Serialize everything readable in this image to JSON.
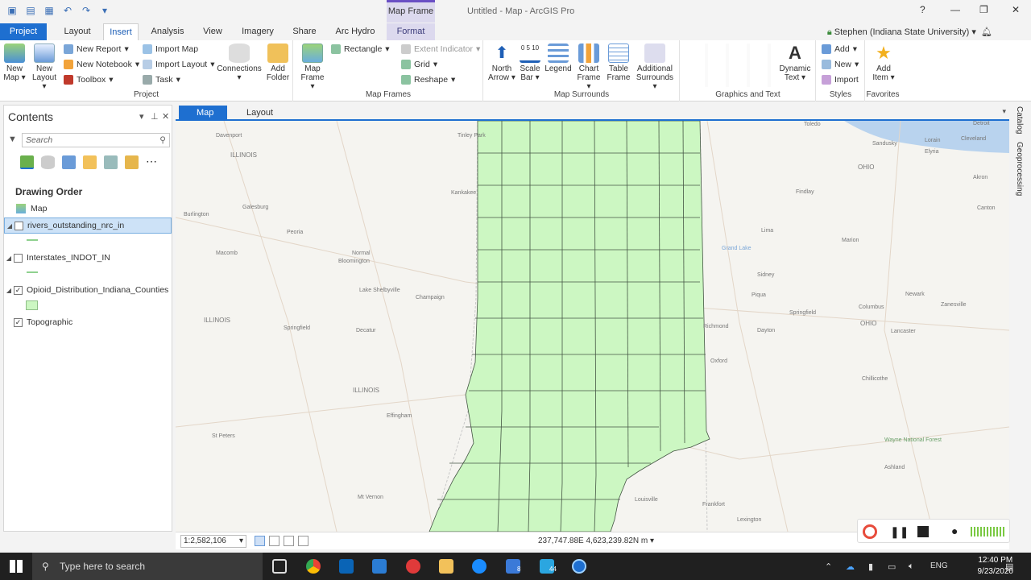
{
  "window": {
    "title": "Untitled - Map - ArcGIS Pro",
    "context_tab_header": "Map Frame"
  },
  "ribbon_tabs": [
    "Project",
    "Layout",
    "Insert",
    "Analysis",
    "View",
    "Imagery",
    "Share",
    "Arc Hydro",
    "Format"
  ],
  "user": "Stephen (Indiana State University)",
  "ribbon": {
    "project": {
      "label": "Project",
      "new_map": "New Map",
      "new_layout": "New Layout",
      "new_report": "New Report",
      "new_notebook": "New Notebook",
      "toolbox": "Toolbox",
      "import_map": "Import Map",
      "import_layout": "Import Layout",
      "task": "Task",
      "connections": "Connections",
      "add_folder": "Add Folder"
    },
    "map_frames": {
      "label": "Map Frames",
      "map_frame": "Map Frame",
      "rectangle": "Rectangle",
      "extent_indicator": "Extent Indicator",
      "grid": "Grid",
      "reshape": "Reshape"
    },
    "map_surrounds": {
      "label": "Map Surrounds",
      "north_arrow": "North Arrow",
      "scale_bar": "Scale Bar",
      "legend": "Legend",
      "chart_frame": "Chart Frame",
      "table_frame": "Table Frame",
      "additional_surrounds": "Additional Surrounds",
      "scale_icon_text": "0 5 10"
    },
    "graphics_text": {
      "label": "Graphics and Text",
      "dynamic_text": "Dynamic Text"
    },
    "styles": {
      "label": "Styles",
      "add": "Add",
      "new": "New",
      "import": "Import"
    },
    "favorites": {
      "label": "Favorites",
      "add_item": "Add Item"
    }
  },
  "contents": {
    "title": "Contents",
    "search_placeholder": "Search",
    "drawing_order": "Drawing Order",
    "map_label": "Map",
    "layers": [
      {
        "name": "rivers_outstanding_nrc_in",
        "checked": false
      },
      {
        "name": "Interstates_INDOT_IN",
        "checked": false
      },
      {
        "name": "Opioid_Distribution_Indiana_Counties",
        "checked": true
      },
      {
        "name": "Topographic",
        "checked": true
      }
    ]
  },
  "view_tabs": {
    "map": "Map",
    "layout": "Layout"
  },
  "map": {
    "fill_color": "#ccf7c2",
    "stroke_color": "#445544",
    "labels": [
      "Detroit",
      "Toledo",
      "Cleveland",
      "Sandusky",
      "Elyria",
      "Lorain",
      "Akron",
      "Canton",
      "Findlay",
      "Lima",
      "Marion",
      "Columbus",
      "Newark",
      "Zanesville",
      "Springfield",
      "Dayton",
      "Lancaster",
      "Chillicothe",
      "Kankakee",
      "Champaign",
      "Decatur",
      "Springfield",
      "Peoria",
      "Bloomington",
      "Normal",
      "Macomb",
      "Galesburg",
      "Burlington",
      "Davenport",
      "Effingham",
      "St Peters",
      "Mt Vernon",
      "Frankfort",
      "Lexington",
      "Oxford",
      "Piqua",
      "Sidney",
      "Richmond",
      "Lake Shelbyville",
      "Grand Lake",
      "Wayne National Forest",
      "Ashland",
      "Louisville",
      "ILLINOIS",
      "ILLINOIS",
      "ILLINOIS",
      "OHIO",
      "OHIO",
      "Tinley Park"
    ]
  },
  "status": {
    "scale": "1:2,582,106",
    "coords": "237,747.88E 4,623,239.82N m"
  },
  "side_panels": [
    "Catalog",
    "Geoprocessing"
  ],
  "taskbar": {
    "search_placeholder": "Type here to search",
    "time": "12:40 PM",
    "date": "9/23/2020",
    "lang": "ENG",
    "badge_a": "8",
    "badge_b": "44"
  }
}
